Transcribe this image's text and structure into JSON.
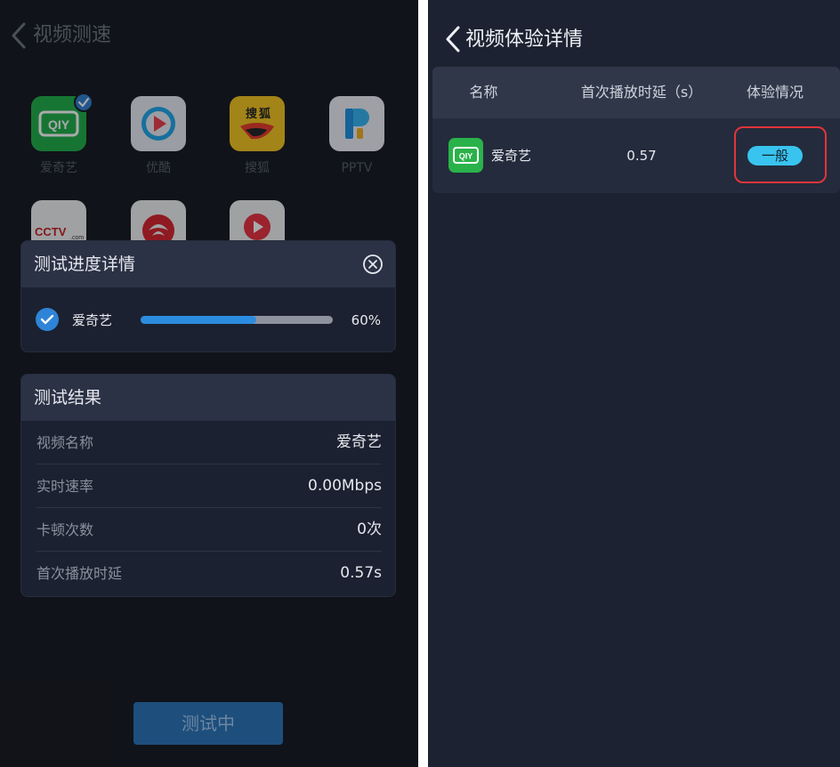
{
  "left": {
    "title": "视频测速",
    "apps": [
      {
        "label": "爱奇艺",
        "icon": "iqiyi-icon",
        "color": "#1fae46",
        "checked": true
      },
      {
        "label": "优酷",
        "icon": "youku-icon",
        "color": "#e9ecf1",
        "checked": false
      },
      {
        "label": "搜狐",
        "icon": "sohu-icon",
        "color": "#f6c51c",
        "checked": false
      },
      {
        "label": "PPTV",
        "icon": "pptv-icon",
        "color": "#eef0f4",
        "checked": false
      },
      {
        "label": "",
        "icon": "cctv-icon",
        "color": "#f2f2f2",
        "checked": false
      },
      {
        "label": "",
        "icon": "phoenix-icon",
        "color": "#f2f2f2",
        "checked": false
      },
      {
        "label": "",
        "icon": "tencent-video-icon",
        "color": "#f2f2f2",
        "checked": false
      }
    ],
    "progress_card": {
      "title": "测试进度详情",
      "app": "爱奇艺",
      "progress": 0.6,
      "percent": "60%"
    },
    "result_card": {
      "title": "测试结果",
      "rows": [
        {
          "label": "视频名称",
          "value": "爱奇艺"
        },
        {
          "label": "实时速率",
          "value": "0.00Mbps"
        },
        {
          "label": "卡顿次数",
          "value": "0次"
        },
        {
          "label": "首次播放时延",
          "value": "0.57s"
        }
      ]
    },
    "button_label": "测试中"
  },
  "right": {
    "title": "视频体验详情",
    "table": {
      "headers": [
        "名称",
        "首次播放时延（s）",
        "体验情况"
      ],
      "row": {
        "name": "爱奇艺",
        "delay": "0.57",
        "experience": "一般"
      }
    }
  },
  "colors": {
    "accent_blue": "#2c8ce0",
    "badge_cyan": "#38c4ee",
    "highlight_red": "#e0343a",
    "iqiyi_green": "#1fae46"
  }
}
